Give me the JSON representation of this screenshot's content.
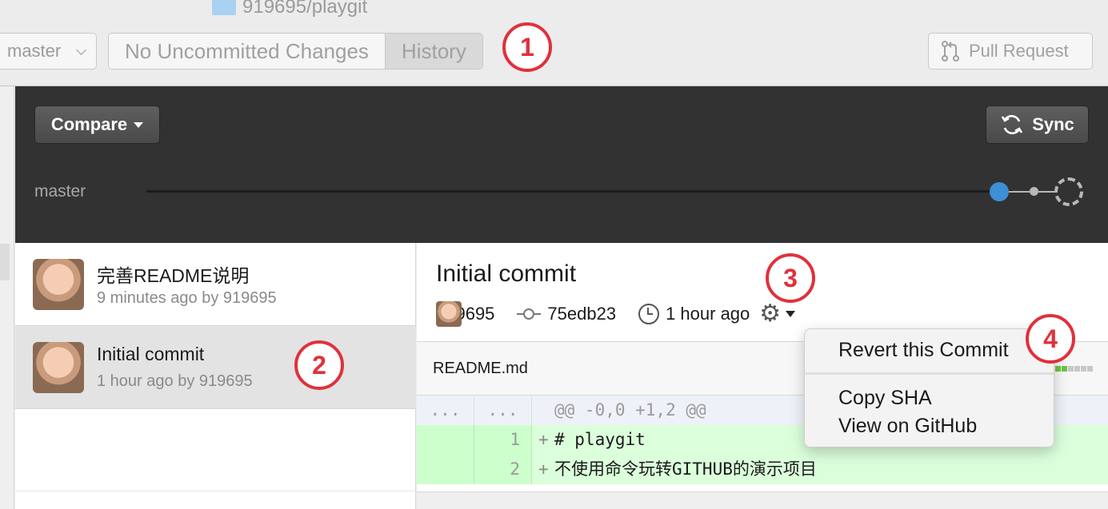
{
  "toolbar": {
    "repo_name": "919695/playgit",
    "branch": "master",
    "tabs": [
      {
        "label": "No Uncommitted Changes",
        "active": false
      },
      {
        "label": "History",
        "active": true
      }
    ],
    "pull_request_label": "Pull Request"
  },
  "header": {
    "compare_label": "Compare",
    "sync_label": "Sync",
    "timeline_branch": "master"
  },
  "commits": [
    {
      "title": "完善README说明",
      "meta": "9 minutes ago by 919695",
      "selected": false
    },
    {
      "title": "Initial commit",
      "meta": "1 hour ago by 919695",
      "selected": true
    }
  ],
  "detail": {
    "title": "Initial commit",
    "author": "919695",
    "sha": "75edb23",
    "time": "1 hour ago",
    "file": {
      "name": "README.md",
      "diff": [
        {
          "type": "hunk",
          "old": "...",
          "new": "...",
          "text": "@@ -0,0 +1,2 @@"
        },
        {
          "type": "add",
          "old": "",
          "new": "1",
          "text": "# playgit"
        },
        {
          "type": "add",
          "old": "",
          "new": "2",
          "text": "不使用命令玩转GITHUB的演示项目"
        }
      ]
    }
  },
  "context_menu": {
    "items": [
      "Revert this Commit",
      "Copy SHA",
      "View on GitHub"
    ]
  },
  "callouts": [
    "1",
    "2",
    "3",
    "4"
  ],
  "colors": {
    "callout": "#e0313b",
    "timeline_dot": "#3d8fd6",
    "diff_add_bg": "#dbffdb",
    "diffstat_add": "#6cc644"
  },
  "icons": [
    "folder-icon",
    "chevron-down-icon",
    "pull-request-icon",
    "sync-icon",
    "commit-icon",
    "clock-icon",
    "gear-icon"
  ]
}
